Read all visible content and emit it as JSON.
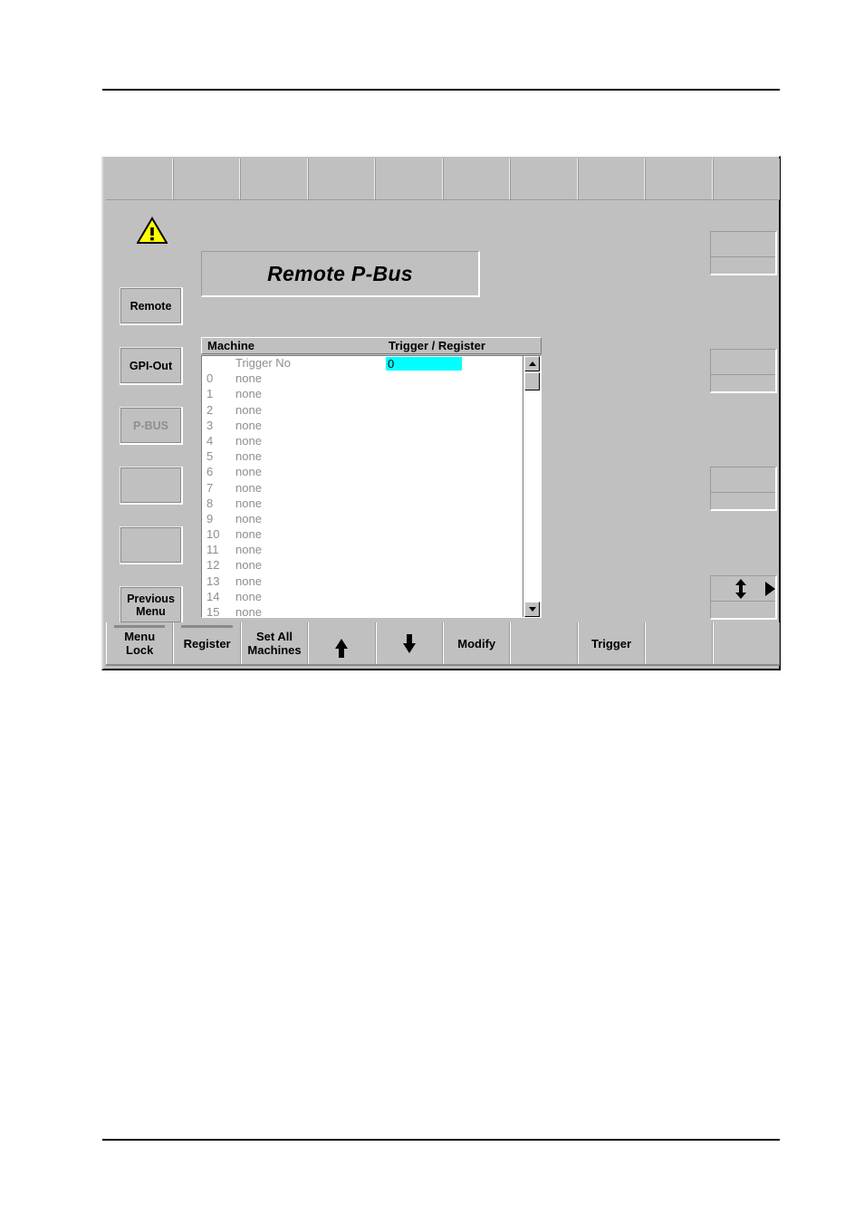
{
  "panel": {
    "title": "Remote P-Bus",
    "warning_icon": "warning-triangle-icon"
  },
  "top_menu": {
    "cell_count": 10,
    "cells": [
      "",
      "",
      "",
      "",
      "",
      "",
      "",
      "",
      "",
      ""
    ]
  },
  "left_rail": {
    "buttons": [
      {
        "label": "Remote",
        "enabled": true
      },
      {
        "label": "GPI-Out",
        "enabled": true
      },
      {
        "label": "P-BUS",
        "enabled": false
      },
      {
        "label": "",
        "enabled": true
      },
      {
        "label": "",
        "enabled": true
      },
      {
        "label": "Previous\nMenu",
        "label_line1": "Previous",
        "label_line2": "Menu",
        "enabled": true
      }
    ]
  },
  "right_rail": {
    "widgets": [
      {
        "upper": "",
        "lower": ""
      },
      {
        "upper": "",
        "lower": ""
      },
      {
        "upper": "",
        "lower": ""
      },
      {
        "upper": "",
        "lower": "",
        "icon": "up-down-arrow-icon",
        "side_icon": "right-triangle-icon"
      }
    ]
  },
  "list": {
    "headers": {
      "machine": "Machine",
      "trigger_register": "Trigger / Register"
    },
    "rows": [
      {
        "id": "",
        "name": "Trigger No",
        "value": "0",
        "highlight": true
      },
      {
        "id": "0",
        "name": "none",
        "value": "",
        "highlight": false
      },
      {
        "id": "1",
        "name": "none",
        "value": "",
        "highlight": false
      },
      {
        "id": "2",
        "name": "none",
        "value": "",
        "highlight": false
      },
      {
        "id": "3",
        "name": "none",
        "value": "",
        "highlight": false
      },
      {
        "id": "4",
        "name": "none",
        "value": "",
        "highlight": false
      },
      {
        "id": "5",
        "name": "none",
        "value": "",
        "highlight": false
      },
      {
        "id": "6",
        "name": "none",
        "value": "",
        "highlight": false
      },
      {
        "id": "7",
        "name": "none",
        "value": "",
        "highlight": false
      },
      {
        "id": "8",
        "name": "none",
        "value": "",
        "highlight": false
      },
      {
        "id": "9",
        "name": "none",
        "value": "",
        "highlight": false
      },
      {
        "id": "10",
        "name": "none",
        "value": "",
        "highlight": false
      },
      {
        "id": "11",
        "name": "none",
        "value": "",
        "highlight": false
      },
      {
        "id": "12",
        "name": "none",
        "value": "",
        "highlight": false
      },
      {
        "id": "13",
        "name": "none",
        "value": "",
        "highlight": false
      },
      {
        "id": "14",
        "name": "none",
        "value": "",
        "highlight": false
      },
      {
        "id": "15",
        "name": "none",
        "value": "",
        "highlight": false
      }
    ],
    "scrollbar": {
      "up_icon": "scroll-up-arrow-icon",
      "down_icon": "scroll-down-arrow-icon"
    }
  },
  "bottom_bar": {
    "keys": [
      {
        "line1": "Menu",
        "line2": "Lock",
        "topbar": true,
        "glyph": ""
      },
      {
        "line1": "Register",
        "line2": "",
        "topbar": true,
        "glyph": ""
      },
      {
        "line1": "Set All",
        "line2": "Machines",
        "topbar": false,
        "glyph": ""
      },
      {
        "line1": "",
        "line2": "",
        "topbar": false,
        "glyph": "arrow-up-icon"
      },
      {
        "line1": "",
        "line2": "",
        "topbar": false,
        "glyph": "arrow-down-icon"
      },
      {
        "line1": "Modify",
        "line2": "",
        "topbar": false,
        "glyph": ""
      },
      {
        "line1": "",
        "line2": "",
        "topbar": false,
        "glyph": ""
      },
      {
        "line1": "Trigger",
        "line2": "",
        "topbar": false,
        "glyph": ""
      },
      {
        "line1": "",
        "line2": "",
        "topbar": false,
        "glyph": ""
      },
      {
        "line1": "",
        "line2": "",
        "topbar": false,
        "glyph": ""
      }
    ]
  },
  "colors": {
    "panel_face": "#c0c0c0",
    "highlight_cyan": "#00ffff",
    "list_text": "#8e8e8e",
    "warning_yellow": "#ffff00"
  }
}
